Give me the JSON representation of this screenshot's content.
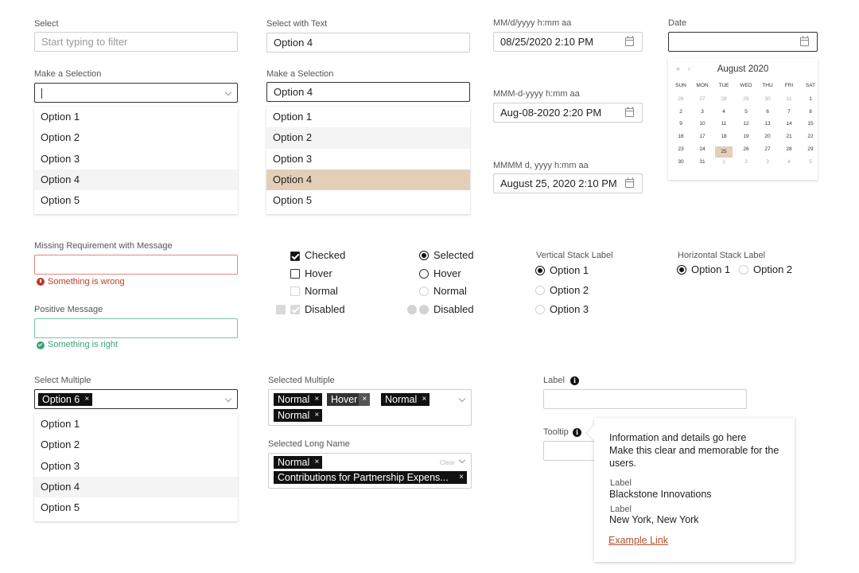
{
  "select": {
    "label": "Select",
    "placeholder": "Start typing to filter"
  },
  "select_with_text": {
    "label": "Select with Text",
    "value": "Option 4"
  },
  "make_selection_1": {
    "label": "Make a Selection",
    "value": "",
    "options": [
      "Option 1",
      "Option 2",
      "Option 3",
      "Option 4",
      "Option 5"
    ]
  },
  "make_selection_2": {
    "label": "Make a Selection",
    "value": "Option 4",
    "options": [
      "Option 1",
      "Option 2",
      "Option 3",
      "Option 4",
      "Option 5"
    ]
  },
  "datetime_1": {
    "label": "MM/d/yyyy h:mm aa",
    "value": "08/25/2020 2:10 PM"
  },
  "datetime_2": {
    "label": "MMM-d-yyyy h:mm aa",
    "value": "Aug-08-2020 2:20 PM"
  },
  "datetime_3": {
    "label": "MMMM d, yyyy h:mm aa",
    "value": "August 25, 2020 2:10 PM"
  },
  "date": {
    "label": "Date",
    "value": "",
    "calendar": {
      "month": "August 2020",
      "nav_first": "«",
      "nav_prev": "‹",
      "weekdays": [
        "SUN",
        "MON",
        "TUE",
        "WED",
        "THU",
        "FRI",
        "SAT"
      ],
      "weeks": [
        [
          "26",
          "27",
          "28",
          "29",
          "30",
          "31",
          "1"
        ],
        [
          "2",
          "3",
          "4",
          "5",
          "6",
          "7",
          "8"
        ],
        [
          "9",
          "10",
          "11",
          "12",
          "13",
          "14",
          "15"
        ],
        [
          "16",
          "17",
          "18",
          "19",
          "20",
          "21",
          "22"
        ],
        [
          "23",
          "24",
          "25",
          "26",
          "27",
          "28",
          "29"
        ],
        [
          "30",
          "31",
          "1",
          "2",
          "3",
          "4",
          "5"
        ]
      ],
      "selected_day": "25"
    }
  },
  "validation": {
    "missing_label": "Missing Requirement with Message",
    "error_message": "Something is wrong",
    "positive_label": "Positive Message",
    "success_message": "Something is right",
    "error_color": "#c0392b",
    "success_color": "#3aa373"
  },
  "checkboxes": {
    "checked": "Checked",
    "hover": "Hover",
    "normal": "Normal",
    "disabled": "Disabled"
  },
  "radios": {
    "selected": "Selected",
    "hover": "Hover",
    "normal": "Normal",
    "disabled": "Disabled"
  },
  "vertical_stack": {
    "label": "Vertical Stack Label",
    "options": [
      "Option 1",
      "Option 2",
      "Option 3"
    ]
  },
  "horizontal_stack": {
    "label": "Horizontal Stack Label",
    "options": [
      "Option 1",
      "Option 2"
    ]
  },
  "select_multiple": {
    "label": "Select Multiple",
    "chip": "Option 6",
    "chip_remove": "×",
    "options": [
      "Option 1",
      "Option 2",
      "Option 3",
      "Option 4",
      "Option 5"
    ]
  },
  "selected_multiple": {
    "label": "Selected Multiple",
    "chips": [
      "Normal",
      "Hover",
      "Normal",
      "Normal"
    ],
    "chip_remove": "×"
  },
  "selected_long_name": {
    "label": "Selected Long Name",
    "chips": [
      "Normal",
      "Contributions for Partnership Expens..."
    ],
    "clear": "Clear",
    "chip_remove": "×"
  },
  "label_field": {
    "label": "Label",
    "info_icon": "i"
  },
  "tooltip_field": {
    "label": "Tooltip",
    "info_icon": "i",
    "tooltip": {
      "line1": "Information and details go here",
      "line2": "Make this clear and memorable for the",
      "line3": "users.",
      "label1": "Label",
      "value1": "Blackstone Innovations",
      "label2": "Label",
      "value2": "New York, New York",
      "link": "Example Link"
    }
  }
}
